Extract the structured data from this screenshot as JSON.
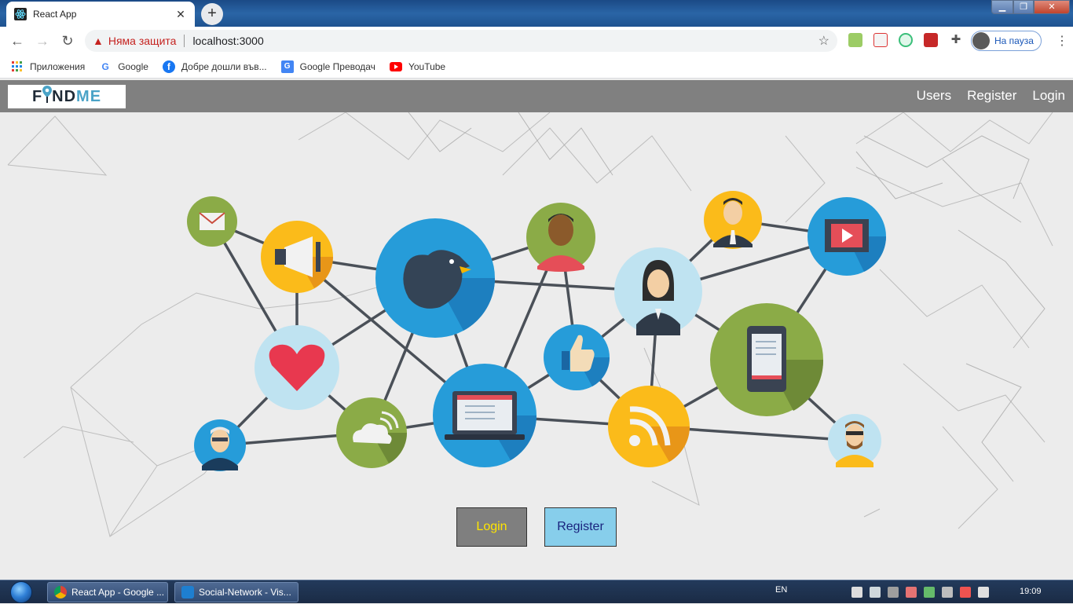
{
  "browser": {
    "tab_title": "React App",
    "tab_close": "✕",
    "new_tab": "+",
    "security_text": "Няма защита",
    "url": "localhost:3000",
    "profile_label": "На пауза"
  },
  "bookmarks": [
    {
      "label": "Приложения",
      "icon": "apps-grid-icon"
    },
    {
      "label": "Google",
      "icon": "google-icon"
    },
    {
      "label": "Добре дошли във...",
      "icon": "facebook-icon"
    },
    {
      "label": "Google Преводач",
      "icon": "google-translate-icon"
    },
    {
      "label": "YouTube",
      "icon": "youtube-icon"
    }
  ],
  "app": {
    "logo": {
      "part1": "F",
      "part2": "ND",
      "part3": "ME"
    },
    "nav": {
      "users": "Users",
      "register": "Register",
      "login": "Login"
    },
    "buttons": {
      "login": "Login",
      "register": "Register"
    },
    "colors": {
      "nav_bg": "#808080",
      "login_bg": "#7f7f7f",
      "login_text": "#ffe600",
      "register_bg": "#87ceeb",
      "register_text": "#1a237e"
    }
  },
  "taskbar": {
    "items": [
      {
        "label": "React App - Google ...",
        "icon": "chrome-icon"
      },
      {
        "label": "Social-Network - Vis...",
        "icon": "vscode-icon"
      }
    ],
    "lang": "EN",
    "time": "19:09"
  }
}
